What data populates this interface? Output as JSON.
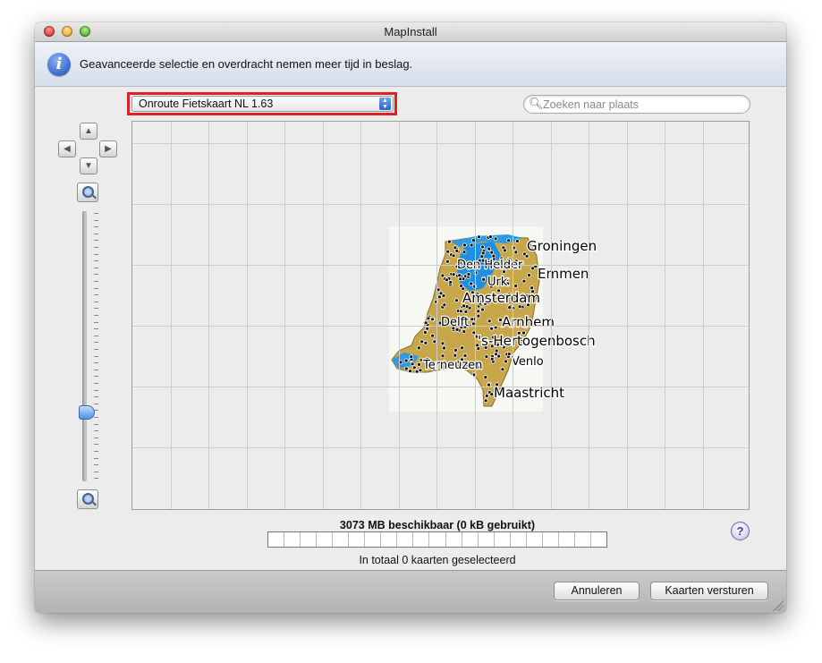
{
  "window": {
    "title": "MapInstall"
  },
  "info": {
    "icon": "info-icon",
    "message": "Geavanceerde selectie en overdracht nemen meer tijd in beslag."
  },
  "map_select": {
    "value": "Onroute Fietskaart NL 1.63"
  },
  "search": {
    "placeholder": "Zoeken naar plaats",
    "value": ""
  },
  "navigation": {
    "up_icon": "arrow-up-icon",
    "down_icon": "arrow-down-icon",
    "left_icon": "arrow-left-icon",
    "right_icon": "arrow-right-icon",
    "zoom_in_icon": "zoom-in-icon",
    "zoom_out_icon": "zoom-out-icon"
  },
  "map": {
    "cities": [
      {
        "name": "Groningen"
      },
      {
        "name": "Den Helder"
      },
      {
        "name": "Emmen"
      },
      {
        "name": "Urk"
      },
      {
        "name": "Amsterdam"
      },
      {
        "name": "Delft"
      },
      {
        "name": "Arnhem"
      },
      {
        "name": "'s-Hertogenbosch"
      },
      {
        "name": "Terneuzen"
      },
      {
        "name": "Venlo"
      },
      {
        "name": "Maastricht"
      }
    ]
  },
  "storage": {
    "available_label": "3073 MB beschikbaar (0 kB gebruikt)",
    "total_label": "In totaal 0 kaarten geselecteerd"
  },
  "help": {
    "label": "?"
  },
  "buttons": {
    "cancel": "Annuleren",
    "send": "Kaarten versturen"
  }
}
